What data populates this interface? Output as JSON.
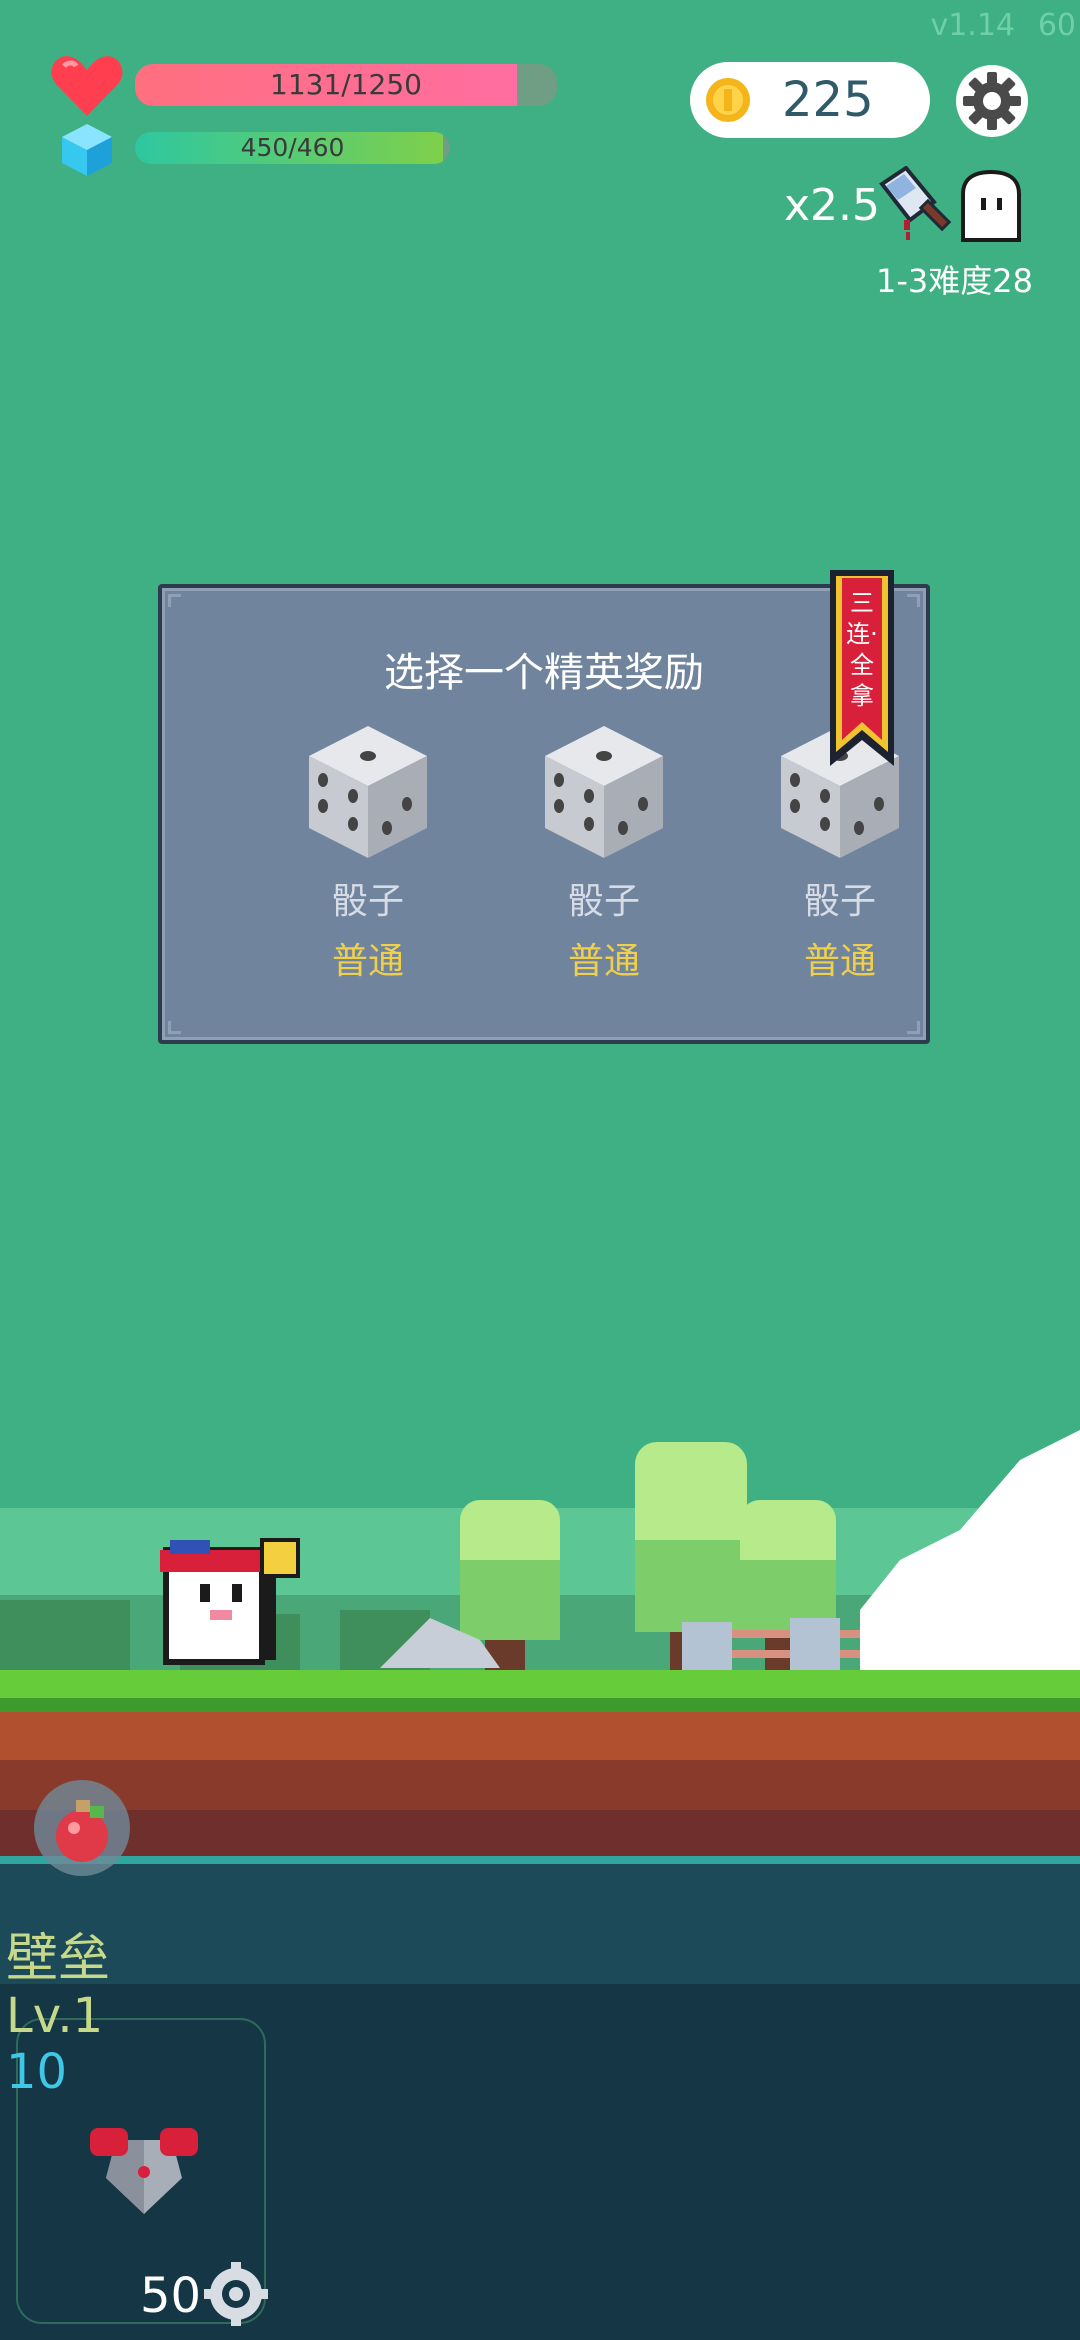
{
  "meta": {
    "version": "v1.14",
    "fps": "60"
  },
  "hud": {
    "hp_text": "1131/1250",
    "hp_fraction": 0.905,
    "mp_text": "450/460",
    "mp_fraction": 0.978,
    "coins": "225",
    "multiplier": "x2.5",
    "stage": "1-3难度28",
    "icons": {
      "hp": "heart-icon",
      "mp": "crystal-icon",
      "coin": "coin-icon",
      "settings": "gear-icon",
      "weapon": "cleaver-icon",
      "enemy": "ghost-icon"
    }
  },
  "dialog": {
    "title": "选择一个精英奖励",
    "ribbon": "三连·全拿",
    "rewards": [
      {
        "name": "骰子",
        "rarity": "普通",
        "icon": "dice-icon"
      },
      {
        "name": "骰子",
        "rarity": "普通",
        "icon": "dice-icon"
      },
      {
        "name": "骰子",
        "rarity": "普通",
        "icon": "dice-icon"
      }
    ]
  },
  "skill": {
    "name": "壁垒",
    "level": "Lv.1",
    "count": "10",
    "cost": "50",
    "icon": "armor-icon",
    "cost_icon": "gear-token-icon"
  },
  "colors": {
    "sky": "#3fb083",
    "hp": "#ff6f7f",
    "mp": "#2ec7a1",
    "panel": "#71849e",
    "rarity_common": "#f0d04a"
  }
}
